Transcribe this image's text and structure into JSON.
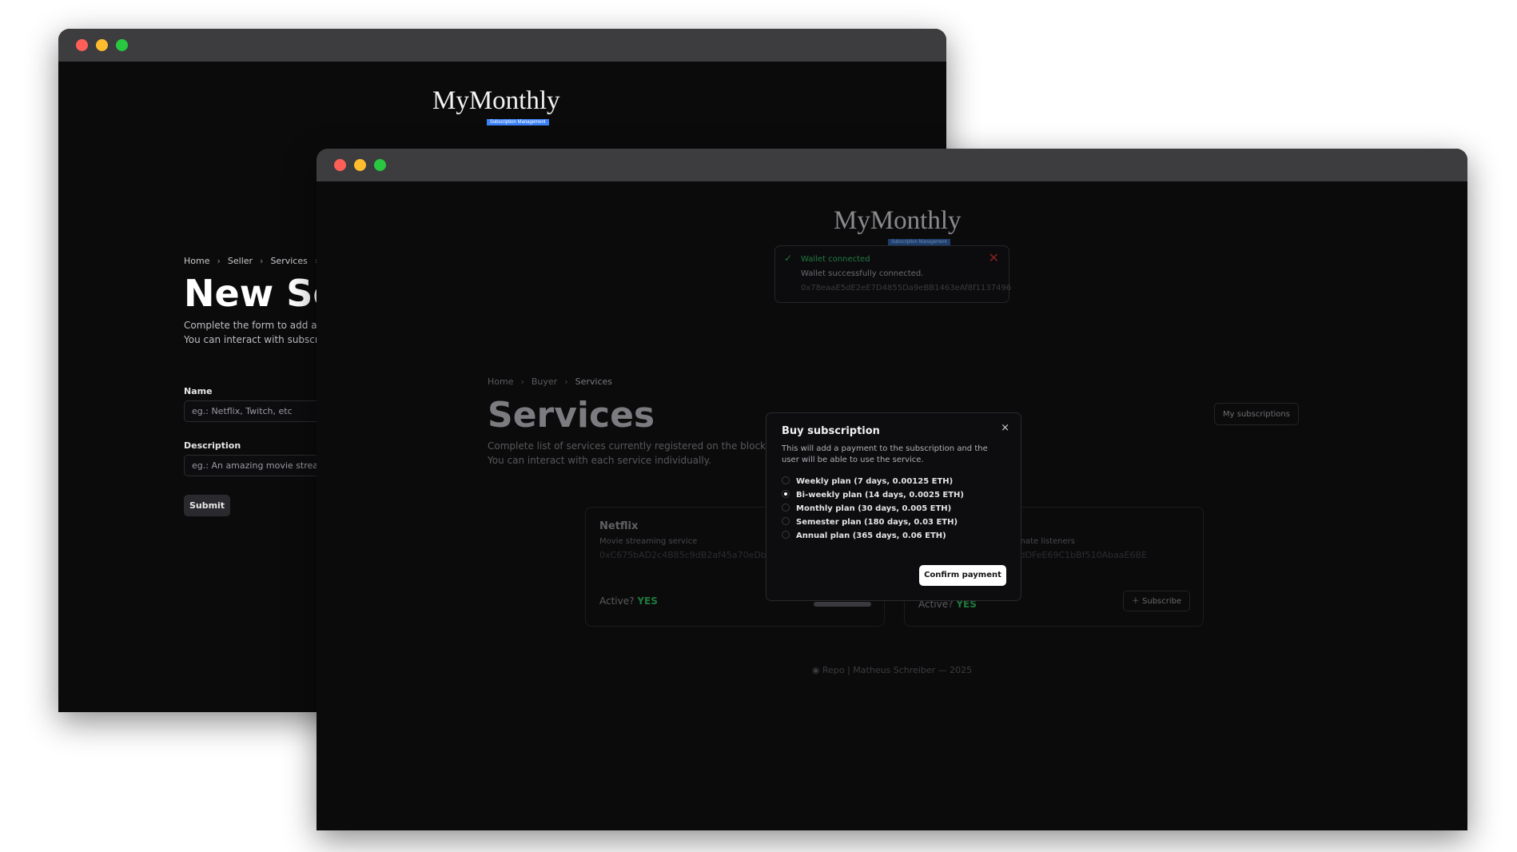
{
  "back_window": {
    "logo": {
      "title": "MyMonthly",
      "badge": "Subscription Management"
    },
    "breadcrumb": [
      "Home",
      "Seller",
      "Services"
    ],
    "heading": "New Se",
    "subtitle_line1": "Complete the form to add a ne",
    "subtitle_line2": "You can interact with subscripi",
    "form": {
      "name_label": "Name",
      "name_placeholder": "eg.: Netflix, Twitch, etc",
      "description_label": "Description",
      "description_placeholder": "eg.: An amazing movie streaming",
      "submit_label": "Submit"
    }
  },
  "front_window": {
    "logo": {
      "title": "MyMonthly",
      "badge": "Subscription Management"
    },
    "toast": {
      "title": "Wallet connected",
      "message": "Wallet successfully connected.",
      "address": "0x78eaaE5dE2eE7D4855Da9eBB1463eAf8f1137496"
    },
    "breadcrumb": [
      "Home",
      "Buyer",
      "Services"
    ],
    "title": "Services",
    "subtitle_line1": "Complete list of services currently registered on the blockchain.",
    "subtitle_line2": "You can interact with each service individually.",
    "my_subscriptions_label": "My subscriptions",
    "cards": [
      {
        "name": "Netflix",
        "description": "Movie streaming service",
        "address": "0xC675bAD2c4B85c9dB2af45a70eDb5",
        "active_label": "Active?",
        "active_value": "YES"
      },
      {
        "name": "",
        "description": "onate listeners",
        "address": "dDFeE69C1bBf510AbaaE6BE",
        "active_label": "Active?",
        "active_value": "YES",
        "subscribe_label": "Subscribe"
      }
    ],
    "footer": {
      "repo": "Repo",
      "credit": "Matheus Schreiber — 2025"
    },
    "modal": {
      "title": "Buy subscription",
      "close": "×",
      "description": "This will add a payment to the subscription and the user will be able to use the service.",
      "options": [
        {
          "label": "Weekly plan (7 days, 0.00125 ETH)",
          "selected": false
        },
        {
          "label": "Bi-weekly plan (14 days, 0.0025 ETH)",
          "selected": true
        },
        {
          "label": "Monthly plan (30 days, 0.005 ETH)",
          "selected": false
        },
        {
          "label": "Semester plan (180 days, 0.03 ETH)",
          "selected": false
        },
        {
          "label": "Annual plan (365 days, 0.06 ETH)",
          "selected": false
        }
      ],
      "confirm_label": "Confirm payment"
    }
  },
  "colors": {
    "window_bg": "#0b0b0c",
    "titlebar": "#3d3d3f",
    "accent_green": "#1f7a3c",
    "badge_blue": "#3b82f6",
    "close_red": "#8a2020"
  }
}
